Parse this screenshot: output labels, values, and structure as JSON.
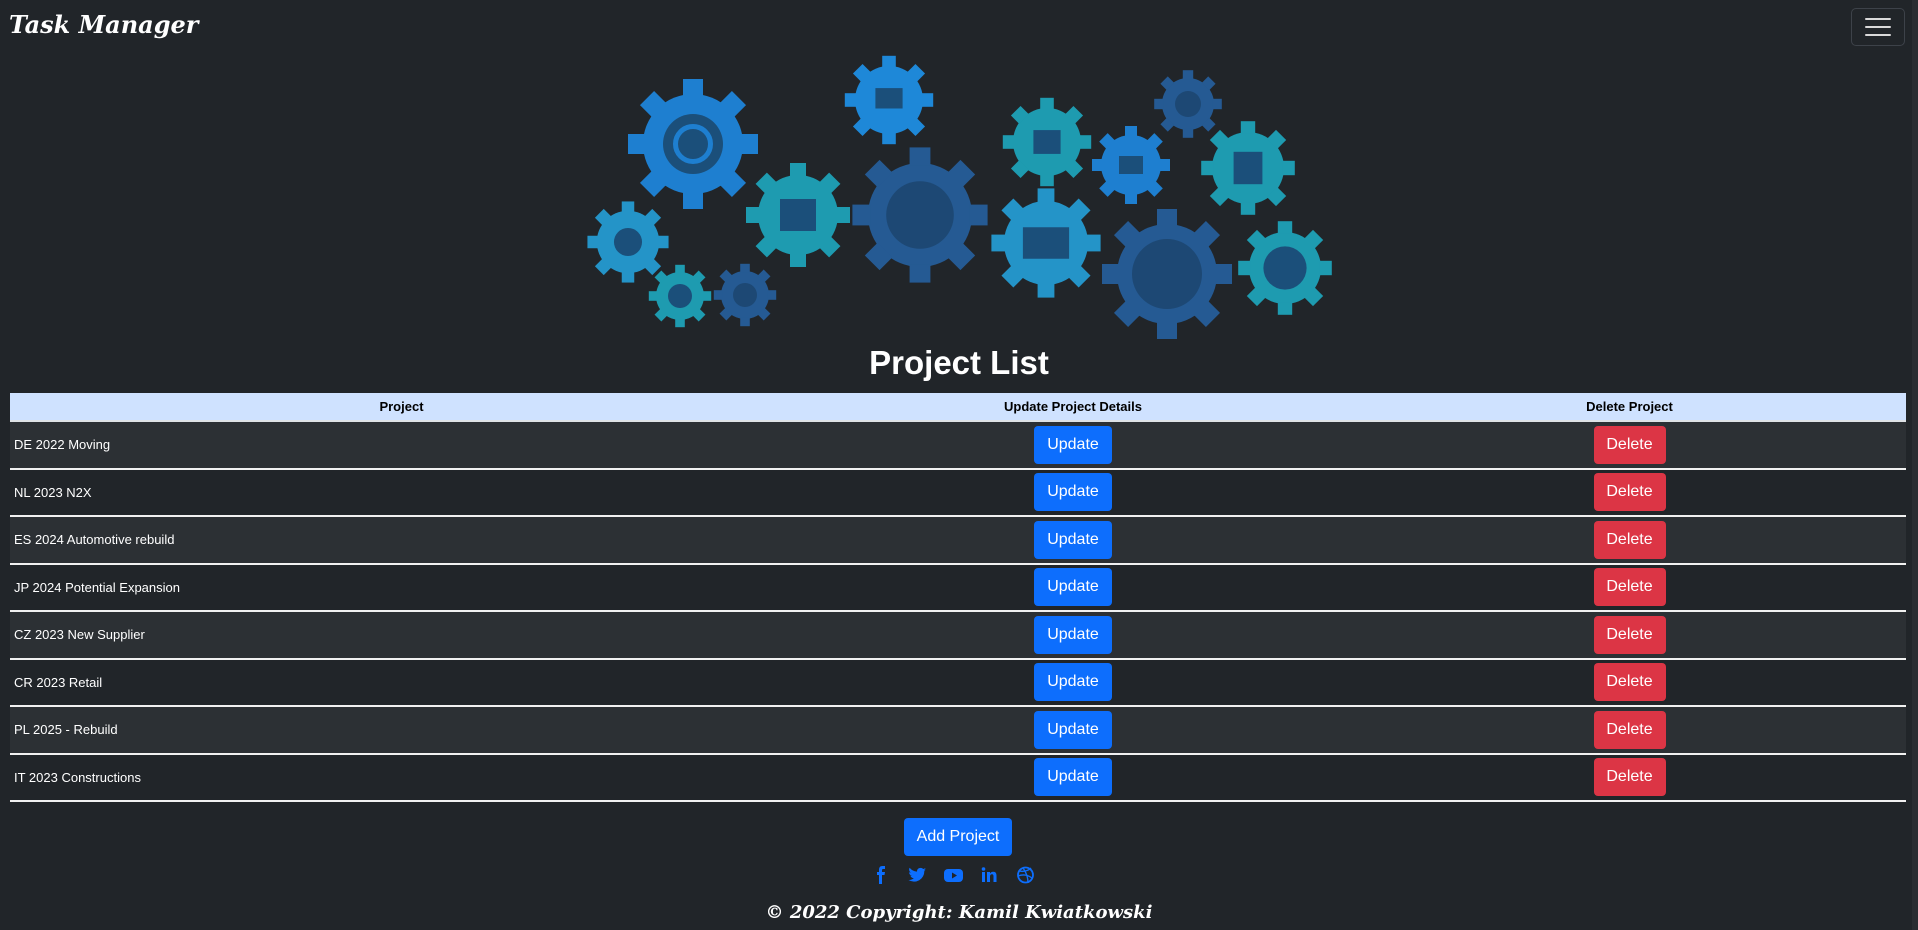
{
  "nav": {
    "brand": "Task Manager"
  },
  "page_title": "Project List",
  "table": {
    "headers": [
      "Project",
      "Update Project Details",
      "Delete Project"
    ],
    "rows": [
      {
        "project": "DE 2022 Moving",
        "update": "Update",
        "delete": "Delete"
      },
      {
        "project": "NL 2023 N2X",
        "update": "Update",
        "delete": "Delete"
      },
      {
        "project": "ES 2024 Automotive rebuild",
        "update": "Update",
        "delete": "Delete"
      },
      {
        "project": "JP 2024 Potential Expansion",
        "update": "Update",
        "delete": "Delete"
      },
      {
        "project": "CZ 2023 New Supplier",
        "update": "Update",
        "delete": "Delete"
      },
      {
        "project": "CR 2023 Retail",
        "update": "Update",
        "delete": "Delete"
      },
      {
        "project": "PL 2025 - Rebuild",
        "update": "Update",
        "delete": "Delete"
      },
      {
        "project": "IT 2023 Constructions",
        "update": "Update",
        "delete": "Delete"
      }
    ]
  },
  "add_project_label": "Add Project",
  "social": [
    "facebook-icon",
    "twitter-icon",
    "youtube-icon",
    "linkedin-icon",
    "dribbble-icon"
  ],
  "footer": {
    "copyright": "© 2022 Copyright: Kamil Kwiatkowski"
  },
  "colors": {
    "background": "#212529",
    "primary": "#0d6efd",
    "danger": "#dc3545",
    "table_header": "#cfe2ff"
  }
}
